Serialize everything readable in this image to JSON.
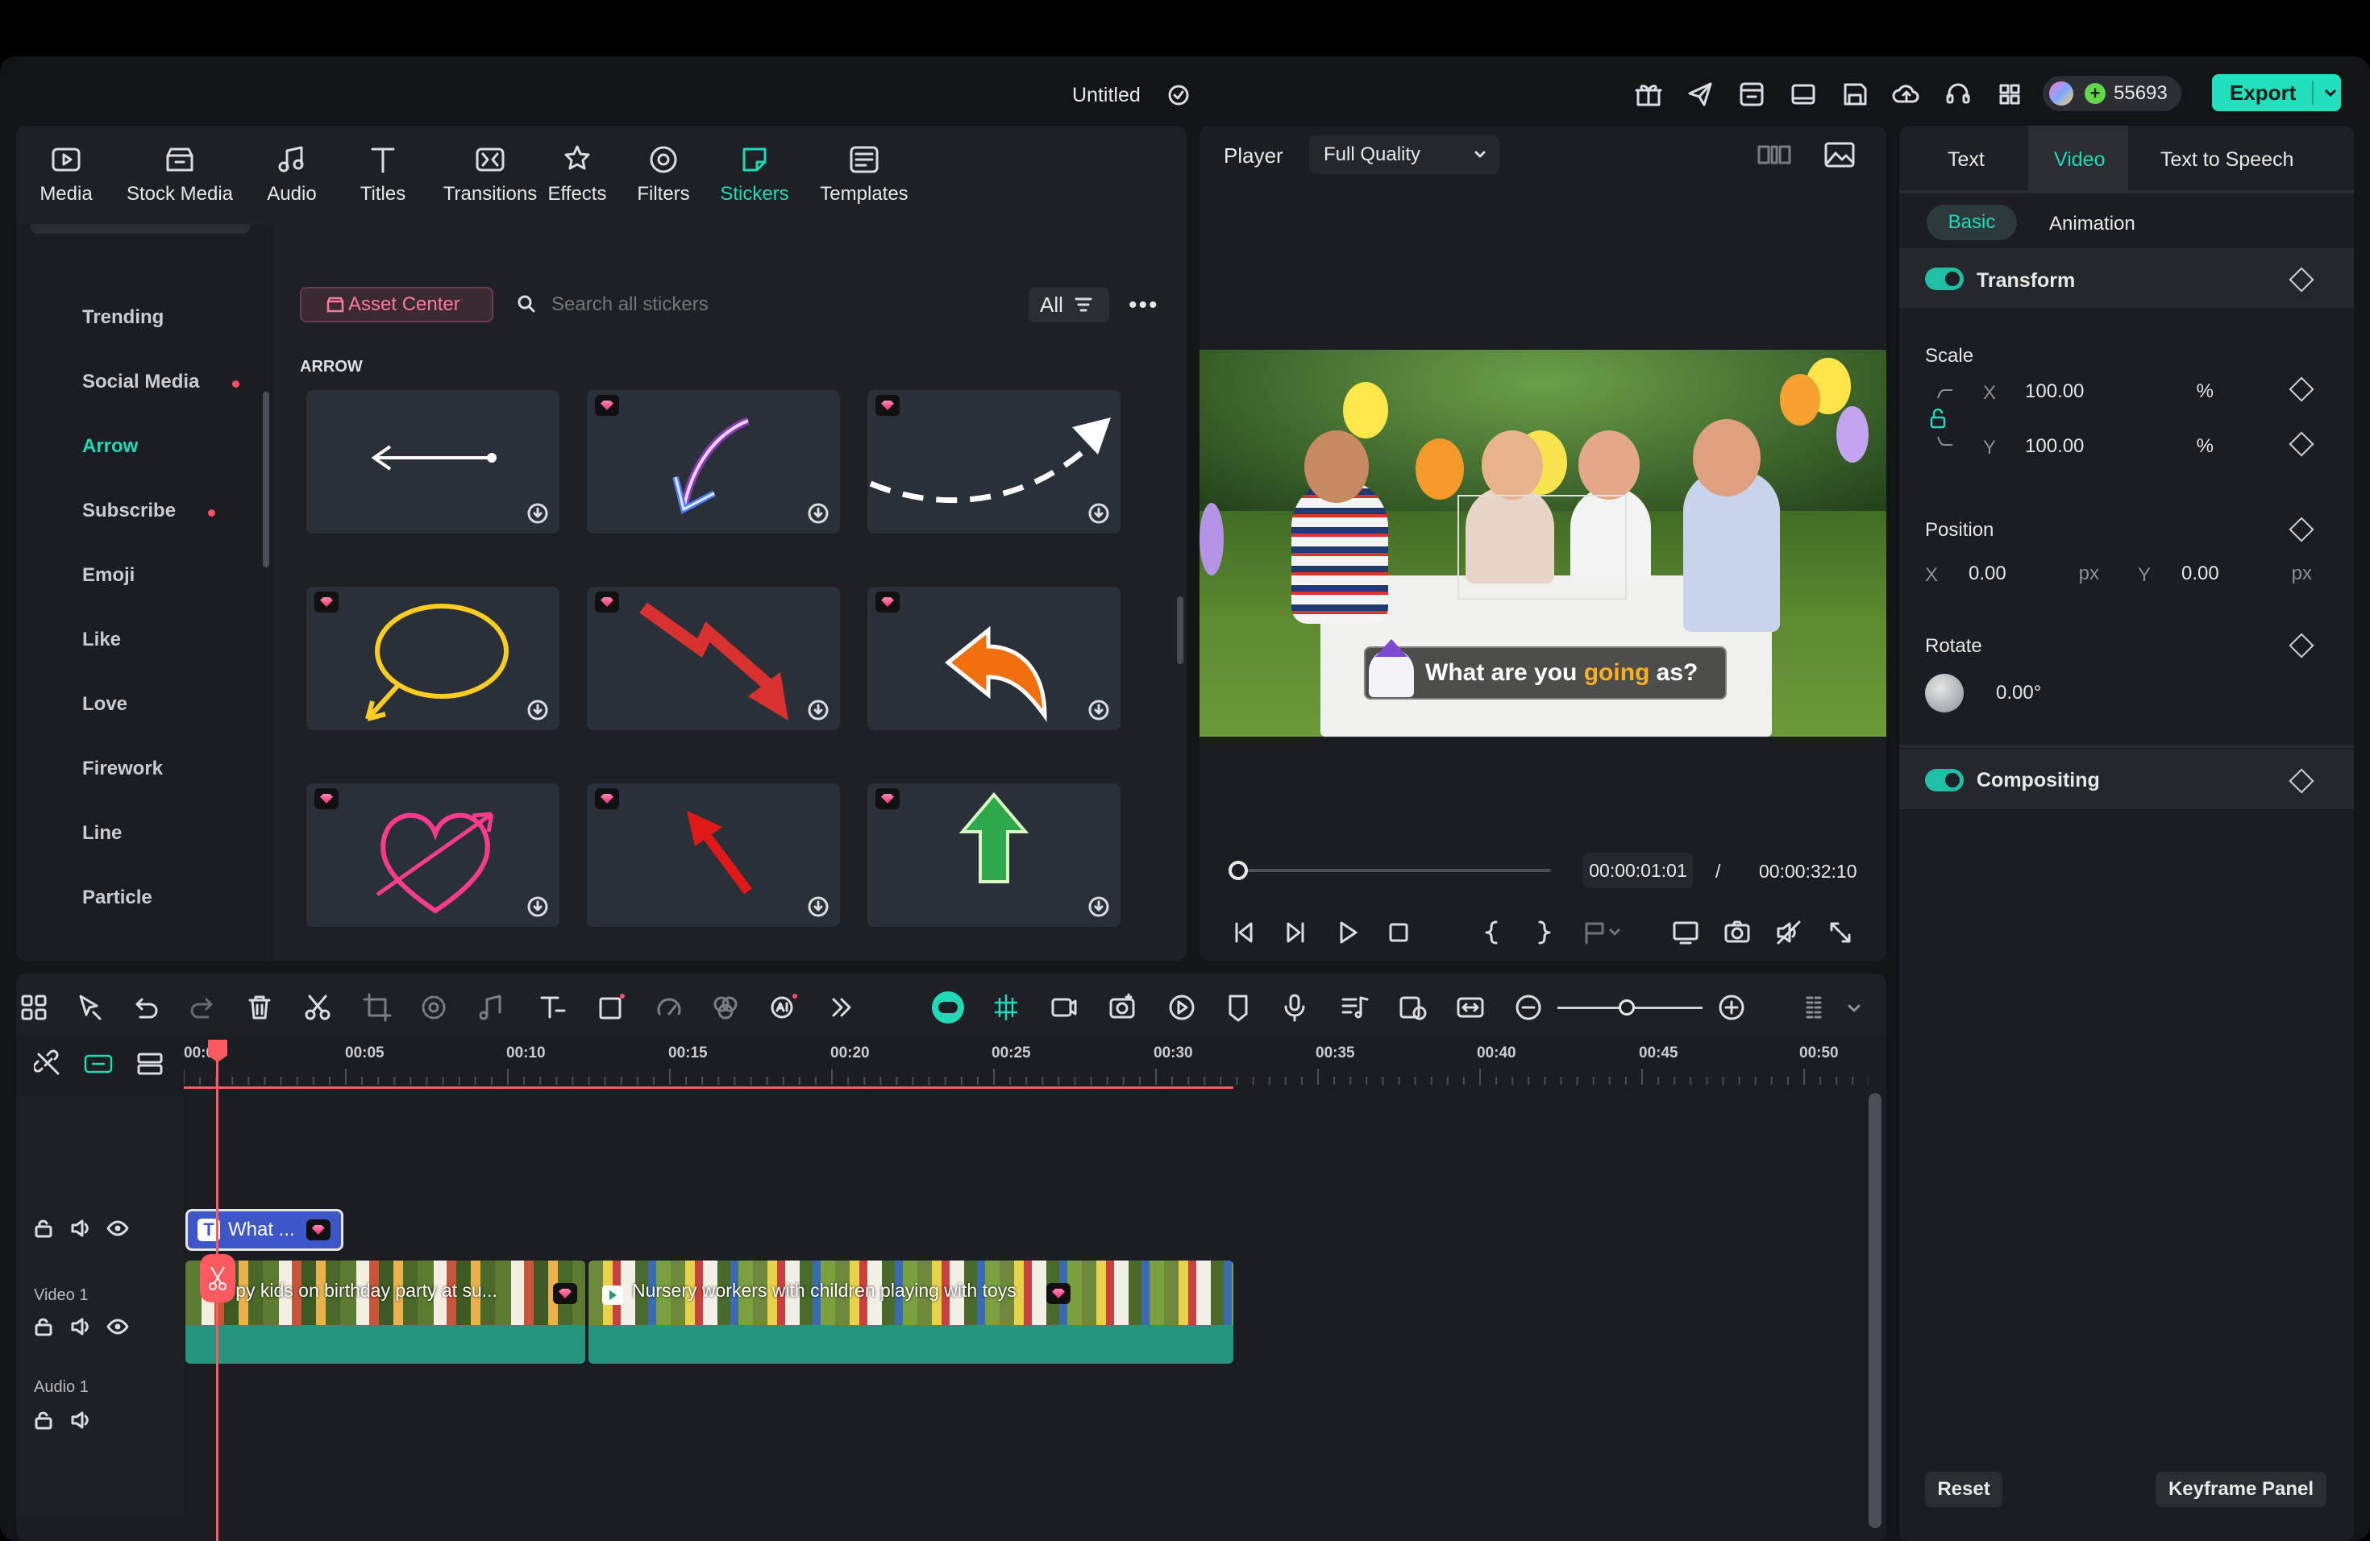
{
  "title_bar": {
    "title": "Untitled",
    "credits": "55693",
    "export_label": "Export"
  },
  "media_tabs": [
    {
      "label": "Media",
      "icon": "media-icon"
    },
    {
      "label": "Stock Media",
      "icon": "stock-media-icon"
    },
    {
      "label": "Audio",
      "icon": "audio-icon"
    },
    {
      "label": "Titles",
      "icon": "titles-icon"
    },
    {
      "label": "Transitions",
      "icon": "transitions-icon"
    },
    {
      "label": "Effects",
      "icon": "effects-icon"
    },
    {
      "label": "Filters",
      "icon": "filters-icon"
    },
    {
      "label": "Stickers",
      "icon": "stickers-icon",
      "active": true
    },
    {
      "label": "Templates",
      "icon": "templates-icon"
    }
  ],
  "sticker_panel": {
    "asset_center": "Asset Center",
    "search_placeholder": "Search all stickers",
    "filter_label": "All",
    "section_label": "ARROW",
    "categories": [
      {
        "label": "Trending"
      },
      {
        "label": "Social Media",
        "dot": true
      },
      {
        "label": "Arrow",
        "active": true
      },
      {
        "label": "Subscribe",
        "dot": true
      },
      {
        "label": "Emoji"
      },
      {
        "label": "Like"
      },
      {
        "label": "Love"
      },
      {
        "label": "Firework"
      },
      {
        "label": "Line"
      },
      {
        "label": "Particle"
      }
    ],
    "stickers": [
      "left-arrow-sticker",
      "neon-arrow-sticker",
      "dashed-arrow-sticker",
      "neon-loop-sticker",
      "zigzag-arrow-sticker",
      "curved-orange-arrow-sticker",
      "love-heart-sticker",
      "red-arrow-sticker",
      "green-up-arrow-sticker"
    ]
  },
  "player": {
    "label": "Player",
    "quality": "Full Quality",
    "caption_before": "What are you ",
    "caption_highlight": "going",
    "caption_after": " as?",
    "current_time": "00:00:01:01",
    "separator": "/",
    "total_time": "00:00:32:10",
    "progress": 0.03
  },
  "inspector": {
    "tabs": [
      "Text",
      "Video",
      "Text to Speech"
    ],
    "active_tab": "Video",
    "subtabs": [
      "Basic",
      "Animation"
    ],
    "transform": "Transform",
    "scale": "Scale",
    "scale_x": "100.00",
    "scale_y": "100.00",
    "x": "X",
    "y": "Y",
    "percent": "%",
    "px": "px",
    "position": "Position",
    "pos_x": "0.00",
    "pos_y": "0.00",
    "rotate": "Rotate",
    "rotate_val": "0.00°",
    "compositing": "Compositing",
    "reset": "Reset",
    "keyframe_panel": "Keyframe Panel"
  },
  "timeline": {
    "ruler": [
      "00:00",
      "00:05",
      "00:10",
      "00:15",
      "00:20",
      "00:25",
      "00:30",
      "00:35",
      "00:40",
      "00:45",
      "00:50"
    ],
    "title_clip": "What ...",
    "video_clip_1": "Happy kids on birthday party at su...",
    "video_clip_2": "Nursery workers with children playing with toys",
    "tracks": {
      "video": "Video 1",
      "audio": "Audio 1"
    },
    "add_track": "+"
  },
  "colors": {
    "accent": "#20d9b8",
    "export": "#22e0bd",
    "playhead": "#ff5a5f",
    "clip": "#27957e"
  }
}
